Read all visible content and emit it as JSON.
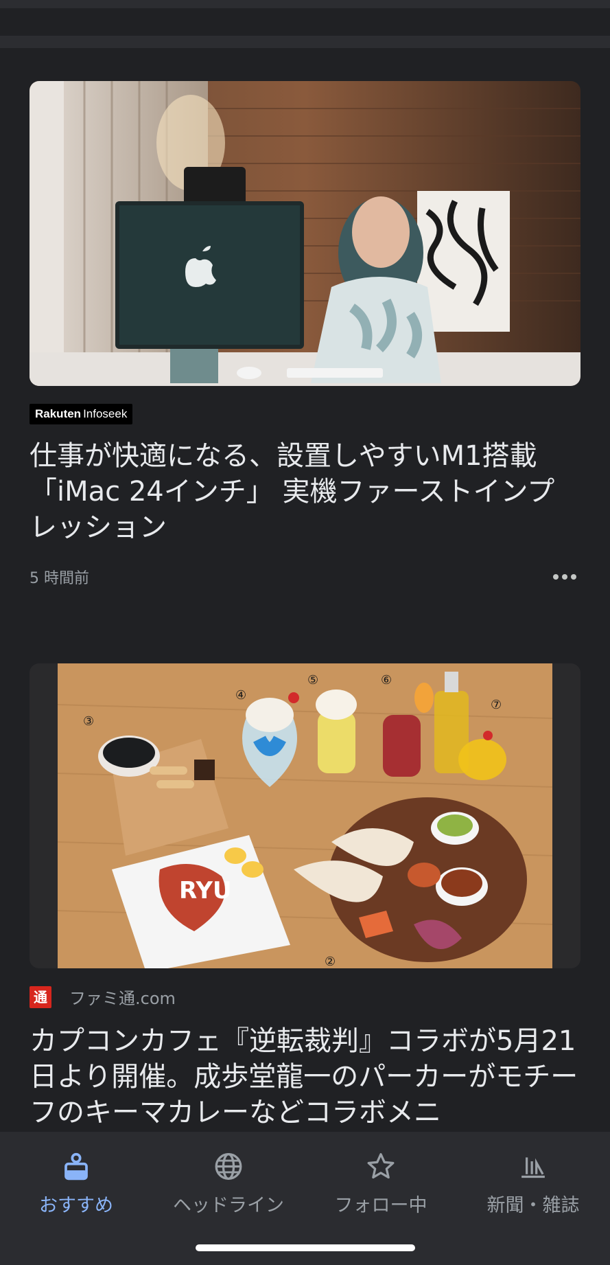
{
  "articles": [
    {
      "source": "Rakuten Infoseek",
      "logo_text_bold": "Rakuten",
      "logo_text": "Infoseek",
      "headline": "仕事が快適になる、設置しやすいM1搭載「iMac 24インチ」 実機ファーストインプレッション",
      "time": "5 時間前",
      "image_icon": "imac-photo"
    },
    {
      "source": "ファミ通.com",
      "logo_glyph": "通",
      "headline": "カプコンカフェ『逆転裁判』コラボが5月21日より開催。成歩堂龍一のパーカーがモチーフのキーマカレーなどコラボメニ",
      "image_icon": "cafe-food-photo",
      "image_text": "RYU",
      "image_numbers": [
        "③",
        "④",
        "⑤",
        "⑥",
        "⑦",
        "②"
      ]
    }
  ],
  "bottom_nav": [
    {
      "label": "おすすめ",
      "icon": "for-you-icon",
      "active": true
    },
    {
      "label": "ヘッドライン",
      "icon": "globe-icon",
      "active": false
    },
    {
      "label": "フォロー中",
      "icon": "star-icon",
      "active": false
    },
    {
      "label": "新聞・雑誌",
      "icon": "newsstand-icon",
      "active": false
    }
  ],
  "colors": {
    "background": "#202124",
    "nav_background": "#2b2c30",
    "accent": "#8ab4f8",
    "text": "#e8eaed",
    "muted": "#9aa0a6"
  }
}
